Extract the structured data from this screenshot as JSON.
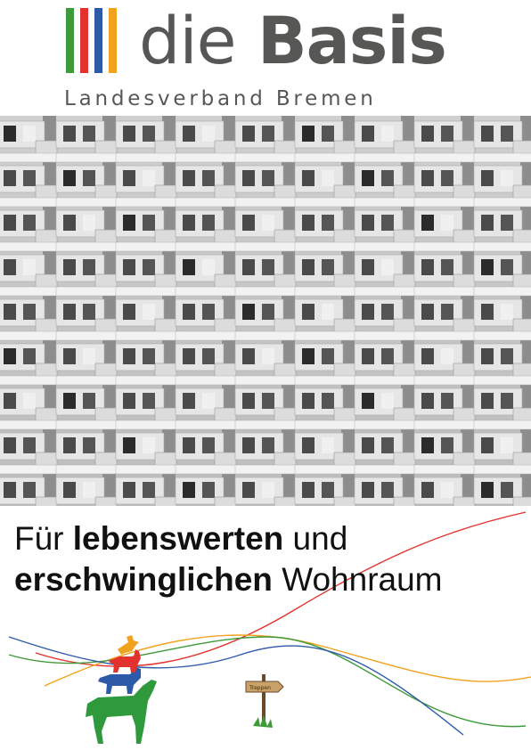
{
  "logo": {
    "word_light": "die",
    "word_bold": "Basis",
    "subtitle": "Landesverband Bremen",
    "stripe_colors": [
      "#3f9b3a",
      "#e3322d",
      "#2d5aa8",
      "#f1a31f"
    ],
    "text_color": "#575756"
  },
  "headline": {
    "line1_regular_a": "Für",
    "line1_bold": "lebenswerten",
    "line1_regular_b": "und",
    "line2_bold": "erschwinglichen",
    "line2_regular": "Wohnraum"
  },
  "signpost": {
    "label": "Treppen"
  },
  "icons": {
    "animals": "bremen-town-musicians-icon",
    "signpost": "signpost-icon",
    "photo": "apartment-block-photo"
  },
  "wave_colors": [
    "#e3322d",
    "#f1a31f",
    "#3f9b3a",
    "#2d5aa8"
  ]
}
